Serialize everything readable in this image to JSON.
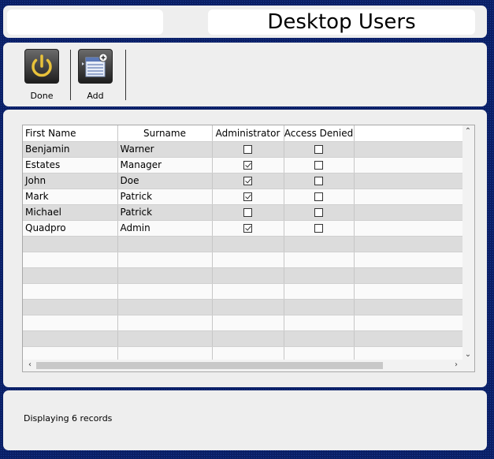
{
  "header": {
    "title": "Desktop Users"
  },
  "toolbar": {
    "done_label": "Done",
    "add_label": "Add",
    "done_icon": "power-icon",
    "add_icon": "add-user-icon"
  },
  "grid": {
    "columns": [
      "First Name",
      "Surname",
      "Administrator",
      "Access Denied"
    ],
    "rows": [
      {
        "first": "Benjamin",
        "surname": "Warner",
        "admin": false,
        "denied": false
      },
      {
        "first": "Estates",
        "surname": "Manager",
        "admin": true,
        "denied": false
      },
      {
        "first": "John",
        "surname": "Doe",
        "admin": true,
        "denied": false
      },
      {
        "first": "Mark",
        "surname": "Patrick",
        "admin": true,
        "denied": false
      },
      {
        "first": "Michael",
        "surname": "Patrick",
        "admin": false,
        "denied": false
      },
      {
        "first": "Quadpro",
        "surname": "Admin",
        "admin": true,
        "denied": false
      }
    ]
  },
  "status": {
    "text": "Displaying 6 records"
  },
  "colors": {
    "background": "#0a1f66",
    "panel": "#eeeeee",
    "icon_accent": "#e8c23a"
  }
}
